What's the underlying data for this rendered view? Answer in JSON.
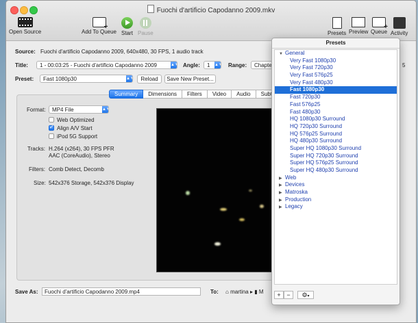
{
  "window": {
    "title": "Fuochi d'artificio Capodanno 2009.mkv"
  },
  "toolbar": {
    "open_source": "Open Source",
    "add_to_queue": "Add To Queue",
    "start": "Start",
    "pause": "Pause",
    "presets": "Presets",
    "preview": "Preview",
    "queue": "Queue",
    "activity": "Activity"
  },
  "source": {
    "label": "Source:",
    "value": "Fuochi d'artificio Capodanno 2009, 640x480, 30 FPS, 1 audio track"
  },
  "title_row": {
    "label": "Title:",
    "value": "1 - 00:03:25 - Fuochi d'artificio Capodanno 2009",
    "angle_label": "Angle:",
    "angle_value": "1",
    "range_label": "Range:",
    "range_value": "Chapte",
    "trailing": "5"
  },
  "preset_row": {
    "label": "Preset:",
    "value": "Fast 1080p30",
    "reload": "Reload",
    "save_new": "Save New Preset..."
  },
  "tabs": [
    "Summary",
    "Dimensions",
    "Filters",
    "Video",
    "Audio",
    "Subtitle"
  ],
  "summary": {
    "format_label": "Format:",
    "format_value": "MP4 File",
    "web_optimized": "Web Optimized",
    "align_av": "Align A/V Start",
    "ipod": "iPod 5G Support",
    "tracks_label": "Tracks:",
    "tracks_line1": "H.264 (x264), 30 FPS PFR",
    "tracks_line2": "AAC (CoreAudio), Stereo",
    "filters_label": "Filters:",
    "filters_value": "Comb Detect, Decomb",
    "size_label": "Size:",
    "size_value": "542x376 Storage, 542x376 Display"
  },
  "save": {
    "label": "Save As:",
    "value": "Fuochi d'artificio Capodanno 2009.mp4",
    "to_label": "To:",
    "to_value": "martina",
    "to_trailing": "M"
  },
  "presets_panel": {
    "title": "Presets",
    "general": "General",
    "items": [
      "Very Fast 1080p30",
      "Very Fast 720p30",
      "Very Fast 576p25",
      "Very Fast 480p30",
      "Fast 1080p30",
      "Fast 720p30",
      "Fast 576p25",
      "Fast 480p30",
      "HQ 1080p30 Surround",
      "HQ 720p30 Surround",
      "HQ 576p25 Surround",
      "HQ 480p30 Surround",
      "Super HQ 1080p30 Surround",
      "Super HQ 720p30 Surround",
      "Super HQ 576p25 Surround",
      "Super HQ 480p30 Surround"
    ],
    "selected": "Fast 1080p30",
    "groups": [
      "Web",
      "Devices",
      "Matroska",
      "Production",
      "Legacy"
    ],
    "add": "+",
    "remove": "−",
    "gear": "⚙"
  }
}
